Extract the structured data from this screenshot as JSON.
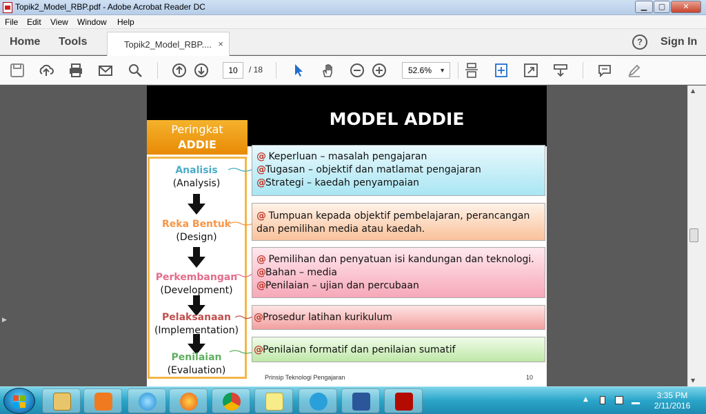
{
  "window": {
    "title": "Topik2_Model_RBP.pdf - Adobe Acrobat Reader DC",
    "min": "▁",
    "max": "▢",
    "close": "✕"
  },
  "menu": [
    "File",
    "Edit",
    "View",
    "Window",
    "Help"
  ],
  "tabs": {
    "home": "Home",
    "tools": "Tools",
    "doc_tab": "Topik2_Model_RBP....",
    "close": "×",
    "help": "?",
    "sign_in": "Sign In"
  },
  "toolbar": {
    "page_current": "10",
    "page_total": "/ 18",
    "zoom": "52.6%",
    "zoom_caret": "▼"
  },
  "slide": {
    "title": "MODEL ADDIE",
    "label_line1": "Peringkat",
    "label_line2": "ADDIE",
    "stages": [
      {
        "name": "Analisis",
        "english": "(Analysis)",
        "color": "#4bacc6"
      },
      {
        "name": "Reka Bentuk",
        "english": "(Design)",
        "color": "#f79646"
      },
      {
        "name": "Perkembangan",
        "english": "(Development)",
        "color": "#e46c8a"
      },
      {
        "name": "Pelaksanaan",
        "english": "(Implementation)",
        "color": "#c0504d"
      },
      {
        "name": "Penilaian",
        "english": "(Evaluation)",
        "color": "#5fae5f"
      }
    ],
    "boxes": [
      {
        "lines": [
          "Keperluan – masalah pengajaran",
          "Tugasan – objektif dan matlamat pengajaran",
          "Strategi – kaedah penyampaian"
        ]
      },
      {
        "lines": [
          "Tumpuan kepada objektif pembelajaran, perancangan",
          "dan pemilihan media atau kaedah."
        ]
      },
      {
        "lines": [
          "Pemilihan dan penyatuan isi kandungan dan teknologi.",
          "Bahan – media",
          "Penilaian – ujian dan percubaan"
        ]
      },
      {
        "lines": [
          "Prosedur latihan kurikulum"
        ]
      },
      {
        "lines": [
          "Penilaian formatif dan penilaian sumatif"
        ]
      }
    ],
    "bullet": "@",
    "footer_text": "Prinsip Teknologi Pengajaran",
    "page_number": "10"
  },
  "taskbar": {
    "time": "3:35 PM",
    "date": "2/11/2016"
  }
}
